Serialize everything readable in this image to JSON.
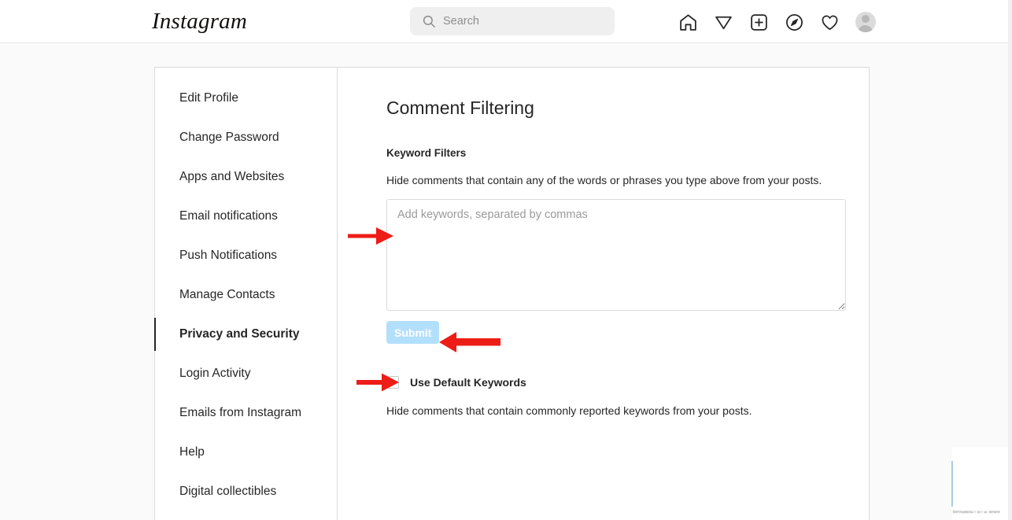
{
  "topbar": {
    "brand": "Instagram",
    "search": {
      "placeholder": "Search",
      "value": "",
      "icon": "search-icon"
    },
    "nav_icons": [
      {
        "name": "home-icon",
        "label": "Home"
      },
      {
        "name": "messenger-send-icon",
        "label": "Messages"
      },
      {
        "name": "new-post-plus-icon",
        "label": "New post"
      },
      {
        "name": "explore-compass-icon",
        "label": "Explore"
      },
      {
        "name": "activity-heart-icon",
        "label": "Notifications"
      },
      {
        "name": "profile-avatar-icon",
        "label": "Profile"
      }
    ]
  },
  "sidebar": {
    "items": [
      {
        "label": "Edit Profile",
        "active": false
      },
      {
        "label": "Change Password",
        "active": false
      },
      {
        "label": "Apps and Websites",
        "active": false
      },
      {
        "label": "Email notifications",
        "active": false
      },
      {
        "label": "Push Notifications",
        "active": false
      },
      {
        "label": "Manage Contacts",
        "active": false
      },
      {
        "label": "Privacy and Security",
        "active": true
      },
      {
        "label": "Login Activity",
        "active": false
      },
      {
        "label": "Emails from Instagram",
        "active": false
      },
      {
        "label": "Help",
        "active": false
      },
      {
        "label": "Digital collectibles",
        "active": false
      }
    ]
  },
  "main": {
    "title": "Comment Filtering",
    "keyword_filters": {
      "label": "Keyword Filters",
      "help": "Hide comments that contain any of the words or phrases you type above from your posts.",
      "textarea_placeholder": "Add keywords, separated by commas",
      "textarea_value": "",
      "submit_label": "Submit",
      "submit_state": "disabled",
      "submit_color": "#b2dffc"
    },
    "default_keywords": {
      "label": "Use Default Keywords",
      "checked": false,
      "help": "Hide comments that contain commonly reported keywords from your posts."
    }
  },
  "annotations": {
    "color": "#ed1c16",
    "arrows": [
      {
        "name": "arrow-to-keyword-textarea",
        "target": "keyword-textarea"
      },
      {
        "name": "arrow-to-submit-button",
        "target": "submit-button"
      },
      {
        "name": "arrow-to-use-default-keywords-checkbox",
        "target": "default-checkbox"
      }
    ]
  },
  "corner_artifact": {
    "text": "Бетльмалы г ш  г ы: млаги"
  }
}
